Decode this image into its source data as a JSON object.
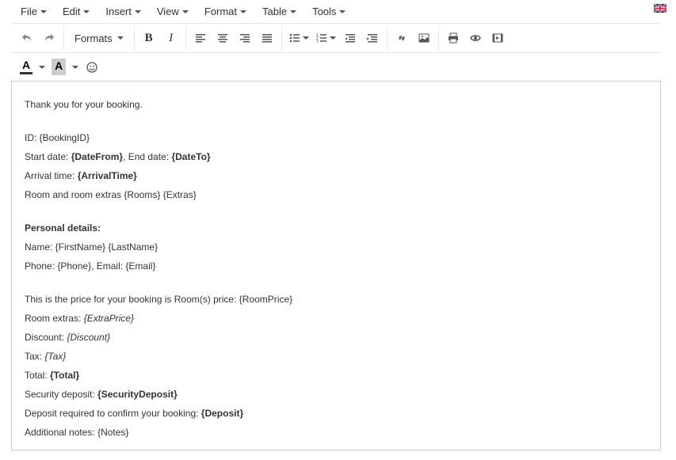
{
  "menu": {
    "file": "File",
    "edit": "Edit",
    "insert": "Insert",
    "view": "View",
    "format": "Format",
    "table": "Table",
    "tools": "Tools"
  },
  "toolbar": {
    "formats": "Formats"
  },
  "textcolor_letter": "A",
  "bgcolor_letter": "A",
  "body": {
    "l1": "Thank you for your booking.",
    "l2a": "ID: {BookingID}",
    "l3a": "Start date: ",
    "l3b": "{DateFrom}",
    "l3c": ", End date: ",
    "l3d": "{DateTo}",
    "l4a": "Arrival time: ",
    "l4b": "{ArrivalTime}",
    "l5": "Room and room extras {Rooms} {Extras}",
    "l6": "Personal details:",
    "l7": "Name: {FirstName} {LastName}",
    "l8": "Phone: {Phone}, Email: {Email}",
    "l9": "This is the price for your booking is Room(s) price: {RoomPrice}",
    "l10a": "Room extras: ",
    "l10b": "{ExtraPrice}",
    "l11a": "Discount: ",
    "l11b": "{Discount}",
    "l12a": "Tax: ",
    "l12b": "{Tax}",
    "l13a": "Total: ",
    "l13b": "{Total}",
    "l14a": "Security deposit: ",
    "l14b": "{SecurityDeposit}",
    "l15a": "Deposit required to confirm your booking: ",
    "l15b": "{Deposit}",
    "l16": "Additional notes: {Notes}"
  }
}
